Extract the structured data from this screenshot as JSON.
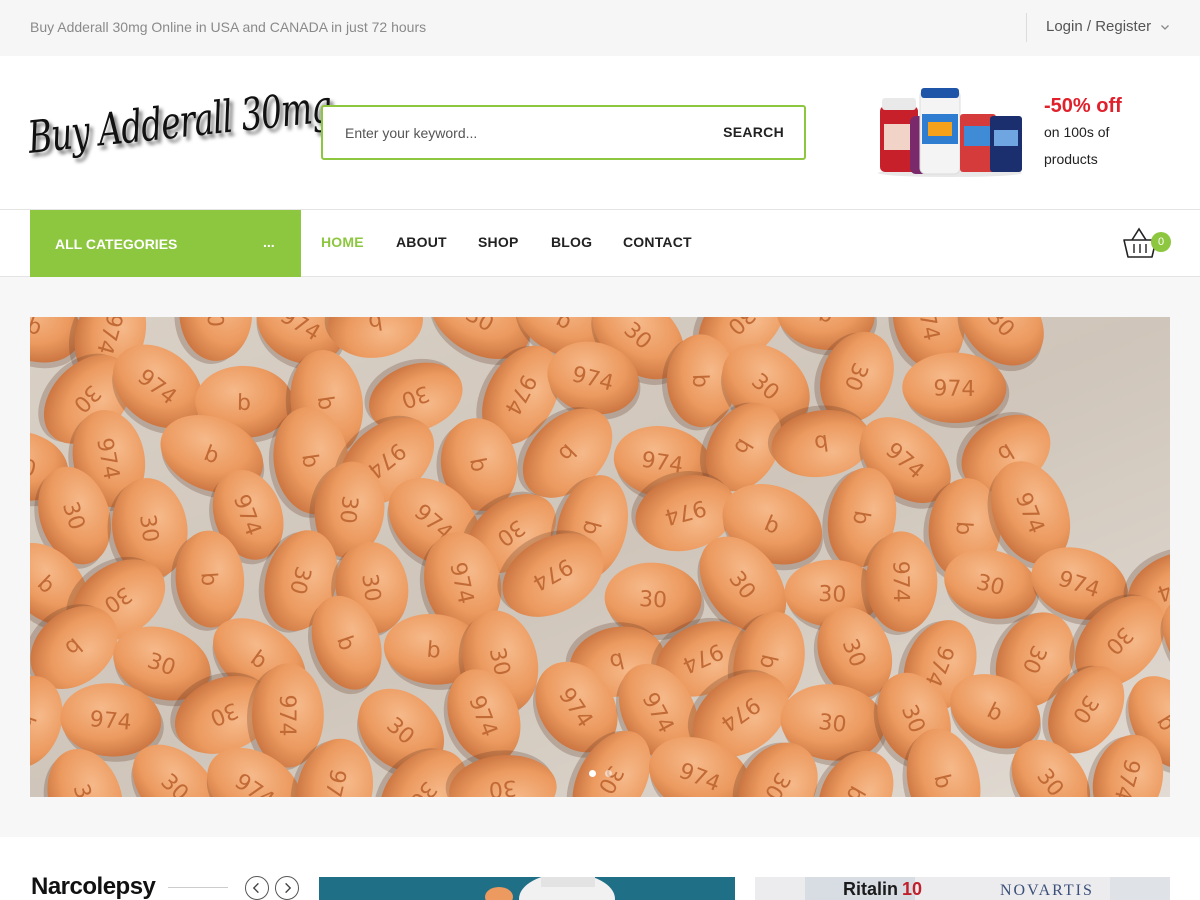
{
  "topbar": {
    "tagline": "Buy Adderall 30mg Online in USA and CANADA in just 72 hours",
    "login_label": "Login / Register"
  },
  "header": {
    "logo_text": "Buy Adderall 30mg",
    "search": {
      "placeholder": "Enter your keyword...",
      "value": "",
      "button_label": "SEARCH"
    },
    "promo": {
      "discount": "-50% off",
      "text": "on 100s of products"
    }
  },
  "nav": {
    "categories_label": "ALL CATEGORIES",
    "categories_dots": "...",
    "items": [
      {
        "label": "HOME",
        "active": true
      },
      {
        "label": "ABOUT",
        "active": false
      },
      {
        "label": "SHOP",
        "active": false
      },
      {
        "label": "BLOG",
        "active": false
      },
      {
        "label": "CONTACT",
        "active": false
      }
    ],
    "cart_count": "0"
  },
  "hero": {
    "pill_imprints": [
      "30",
      "b",
      "974"
    ],
    "slides": 2,
    "active_slide": 1
  },
  "section": {
    "title": "Narcolepsy",
    "card2_text": [
      "Ritalin",
      "10",
      "NOVARTIS"
    ]
  },
  "colors": {
    "accent": "#8dc63f",
    "promo_red": "#e0202b",
    "pill": "#eb9a5e"
  }
}
